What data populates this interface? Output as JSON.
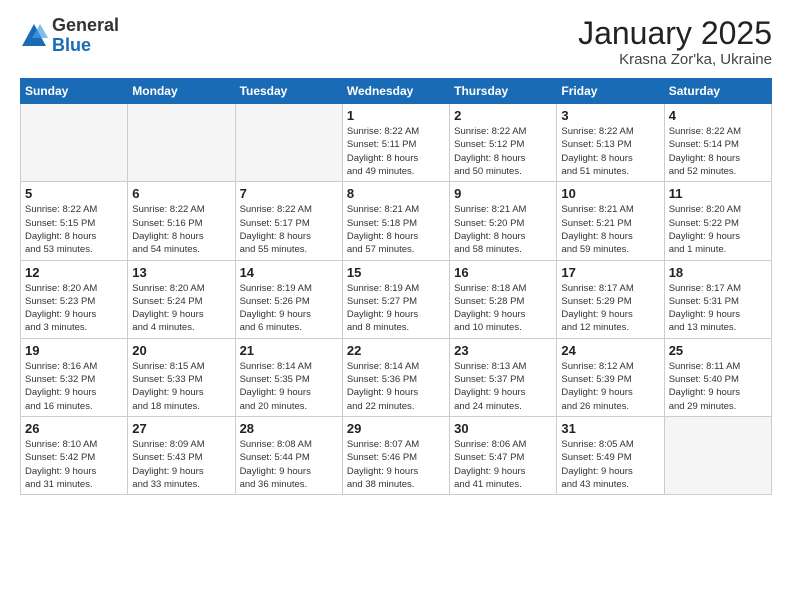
{
  "logo": {
    "general": "General",
    "blue": "Blue"
  },
  "title": "January 2025",
  "location": "Krasna Zor'ka, Ukraine",
  "days_header": [
    "Sunday",
    "Monday",
    "Tuesday",
    "Wednesday",
    "Thursday",
    "Friday",
    "Saturday"
  ],
  "weeks": [
    {
      "days": [
        {
          "num": "",
          "info": ""
        },
        {
          "num": "",
          "info": ""
        },
        {
          "num": "",
          "info": ""
        },
        {
          "num": "1",
          "info": "Sunrise: 8:22 AM\nSunset: 5:11 PM\nDaylight: 8 hours\nand 49 minutes."
        },
        {
          "num": "2",
          "info": "Sunrise: 8:22 AM\nSunset: 5:12 PM\nDaylight: 8 hours\nand 50 minutes."
        },
        {
          "num": "3",
          "info": "Sunrise: 8:22 AM\nSunset: 5:13 PM\nDaylight: 8 hours\nand 51 minutes."
        },
        {
          "num": "4",
          "info": "Sunrise: 8:22 AM\nSunset: 5:14 PM\nDaylight: 8 hours\nand 52 minutes."
        }
      ]
    },
    {
      "days": [
        {
          "num": "5",
          "info": "Sunrise: 8:22 AM\nSunset: 5:15 PM\nDaylight: 8 hours\nand 53 minutes."
        },
        {
          "num": "6",
          "info": "Sunrise: 8:22 AM\nSunset: 5:16 PM\nDaylight: 8 hours\nand 54 minutes."
        },
        {
          "num": "7",
          "info": "Sunrise: 8:22 AM\nSunset: 5:17 PM\nDaylight: 8 hours\nand 55 minutes."
        },
        {
          "num": "8",
          "info": "Sunrise: 8:21 AM\nSunset: 5:18 PM\nDaylight: 8 hours\nand 57 minutes."
        },
        {
          "num": "9",
          "info": "Sunrise: 8:21 AM\nSunset: 5:20 PM\nDaylight: 8 hours\nand 58 minutes."
        },
        {
          "num": "10",
          "info": "Sunrise: 8:21 AM\nSunset: 5:21 PM\nDaylight: 8 hours\nand 59 minutes."
        },
        {
          "num": "11",
          "info": "Sunrise: 8:20 AM\nSunset: 5:22 PM\nDaylight: 9 hours\nand 1 minute."
        }
      ]
    },
    {
      "days": [
        {
          "num": "12",
          "info": "Sunrise: 8:20 AM\nSunset: 5:23 PM\nDaylight: 9 hours\nand 3 minutes."
        },
        {
          "num": "13",
          "info": "Sunrise: 8:20 AM\nSunset: 5:24 PM\nDaylight: 9 hours\nand 4 minutes."
        },
        {
          "num": "14",
          "info": "Sunrise: 8:19 AM\nSunset: 5:26 PM\nDaylight: 9 hours\nand 6 minutes."
        },
        {
          "num": "15",
          "info": "Sunrise: 8:19 AM\nSunset: 5:27 PM\nDaylight: 9 hours\nand 8 minutes."
        },
        {
          "num": "16",
          "info": "Sunrise: 8:18 AM\nSunset: 5:28 PM\nDaylight: 9 hours\nand 10 minutes."
        },
        {
          "num": "17",
          "info": "Sunrise: 8:17 AM\nSunset: 5:29 PM\nDaylight: 9 hours\nand 12 minutes."
        },
        {
          "num": "18",
          "info": "Sunrise: 8:17 AM\nSunset: 5:31 PM\nDaylight: 9 hours\nand 13 minutes."
        }
      ]
    },
    {
      "days": [
        {
          "num": "19",
          "info": "Sunrise: 8:16 AM\nSunset: 5:32 PM\nDaylight: 9 hours\nand 16 minutes."
        },
        {
          "num": "20",
          "info": "Sunrise: 8:15 AM\nSunset: 5:33 PM\nDaylight: 9 hours\nand 18 minutes."
        },
        {
          "num": "21",
          "info": "Sunrise: 8:14 AM\nSunset: 5:35 PM\nDaylight: 9 hours\nand 20 minutes."
        },
        {
          "num": "22",
          "info": "Sunrise: 8:14 AM\nSunset: 5:36 PM\nDaylight: 9 hours\nand 22 minutes."
        },
        {
          "num": "23",
          "info": "Sunrise: 8:13 AM\nSunset: 5:37 PM\nDaylight: 9 hours\nand 24 minutes."
        },
        {
          "num": "24",
          "info": "Sunrise: 8:12 AM\nSunset: 5:39 PM\nDaylight: 9 hours\nand 26 minutes."
        },
        {
          "num": "25",
          "info": "Sunrise: 8:11 AM\nSunset: 5:40 PM\nDaylight: 9 hours\nand 29 minutes."
        }
      ]
    },
    {
      "days": [
        {
          "num": "26",
          "info": "Sunrise: 8:10 AM\nSunset: 5:42 PM\nDaylight: 9 hours\nand 31 minutes."
        },
        {
          "num": "27",
          "info": "Sunrise: 8:09 AM\nSunset: 5:43 PM\nDaylight: 9 hours\nand 33 minutes."
        },
        {
          "num": "28",
          "info": "Sunrise: 8:08 AM\nSunset: 5:44 PM\nDaylight: 9 hours\nand 36 minutes."
        },
        {
          "num": "29",
          "info": "Sunrise: 8:07 AM\nSunset: 5:46 PM\nDaylight: 9 hours\nand 38 minutes."
        },
        {
          "num": "30",
          "info": "Sunrise: 8:06 AM\nSunset: 5:47 PM\nDaylight: 9 hours\nand 41 minutes."
        },
        {
          "num": "31",
          "info": "Sunrise: 8:05 AM\nSunset: 5:49 PM\nDaylight: 9 hours\nand 43 minutes."
        },
        {
          "num": "",
          "info": ""
        }
      ]
    }
  ]
}
